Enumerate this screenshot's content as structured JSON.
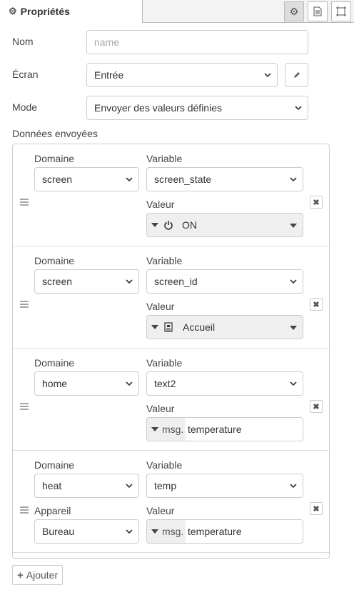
{
  "tabs": {
    "properties_label": "Propriétés"
  },
  "form": {
    "name_label": "Nom",
    "name_placeholder": "name",
    "screen_label": "Écran",
    "screen_value": "Entrée",
    "mode_label": "Mode",
    "mode_value": "Envoyer des valeurs définies",
    "sent_data_label": "Données envoyées"
  },
  "rows": [
    {
      "domain_label": "Domaine",
      "domain": "screen",
      "variable_label": "Variable",
      "variable": "screen_state",
      "value_label": "Valeur",
      "value": "ON"
    },
    {
      "domain_label": "Domaine",
      "domain": "screen",
      "variable_label": "Variable",
      "variable": "screen_id",
      "value_label": "Valeur",
      "value": "Accueil"
    },
    {
      "domain_label": "Domaine",
      "domain": "home",
      "variable_label": "Variable",
      "variable": "text2",
      "value_label": "Valeur",
      "value_type": "msg.",
      "value": "temperature"
    },
    {
      "domain_label": "Domaine",
      "domain": "heat",
      "variable_label": "Variable",
      "variable": "temp",
      "device_label": "Appareil",
      "device": "Bureau",
      "value_label": "Valeur",
      "value_type": "msg.",
      "value": "temperature"
    }
  ],
  "add_label": "Ajouter"
}
